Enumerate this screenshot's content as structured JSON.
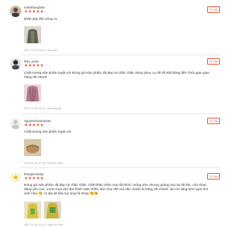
{
  "reviews": [
    {
      "username": "minhthanghan",
      "stars": "★★★★★",
      "comment": "khấn  dẹp lắm  shop   ra",
      "meta": "2017-10-18 20:57 | nấu vỗa",
      "report_label": "Tố Cáo"
    },
    {
      "username": "tran_yuan",
      "stars": "★★★★★",
      "comment": "Chất lượng sản phẩm tuyệt vời Đóng gói sản phẩm rất đẹp và chắc chắn Shop phục vụ rất tốt Rất đáng tiền Thời gian giao hàng rất nhanh",
      "meta": "2017-11-30 22:10 | ôm nhạt yry",
      "report_label": "Tố Cáo"
    },
    {
      "username": "nguyenhoa218181",
      "stars": "★★★★★",
      "comment": "Chất lượng sản phẩm tuyệt vời",
      "meta": "2017-11-26 11:34 | Sanh ôn theo",
      "report_label": "Tố Cáo"
    },
    {
      "username": "thangmuoitoy",
      "stars": "★★★★★",
      "comment": "Đóng gói sản phẩm rất đẹp và chắc chắn. chất khăn mềm mại rất thích. mỏng nhe nhưng quàng vào lại rất ấm. chủ shop đáng yêu cực, mình mua vào đợt flash sale nhiều đơn như thế mà vẫn chuẩn bị hàng rất nhanh. lại còn tặng kèm quà nhỏ xinh nữa 😊 có dịp sẽ tiếp tục ủng hộ shop 😘😘",
      "meta": "2017-11-26 11:14 | Sanh ôn theo",
      "report_label": "Tố Cáo"
    }
  ]
}
